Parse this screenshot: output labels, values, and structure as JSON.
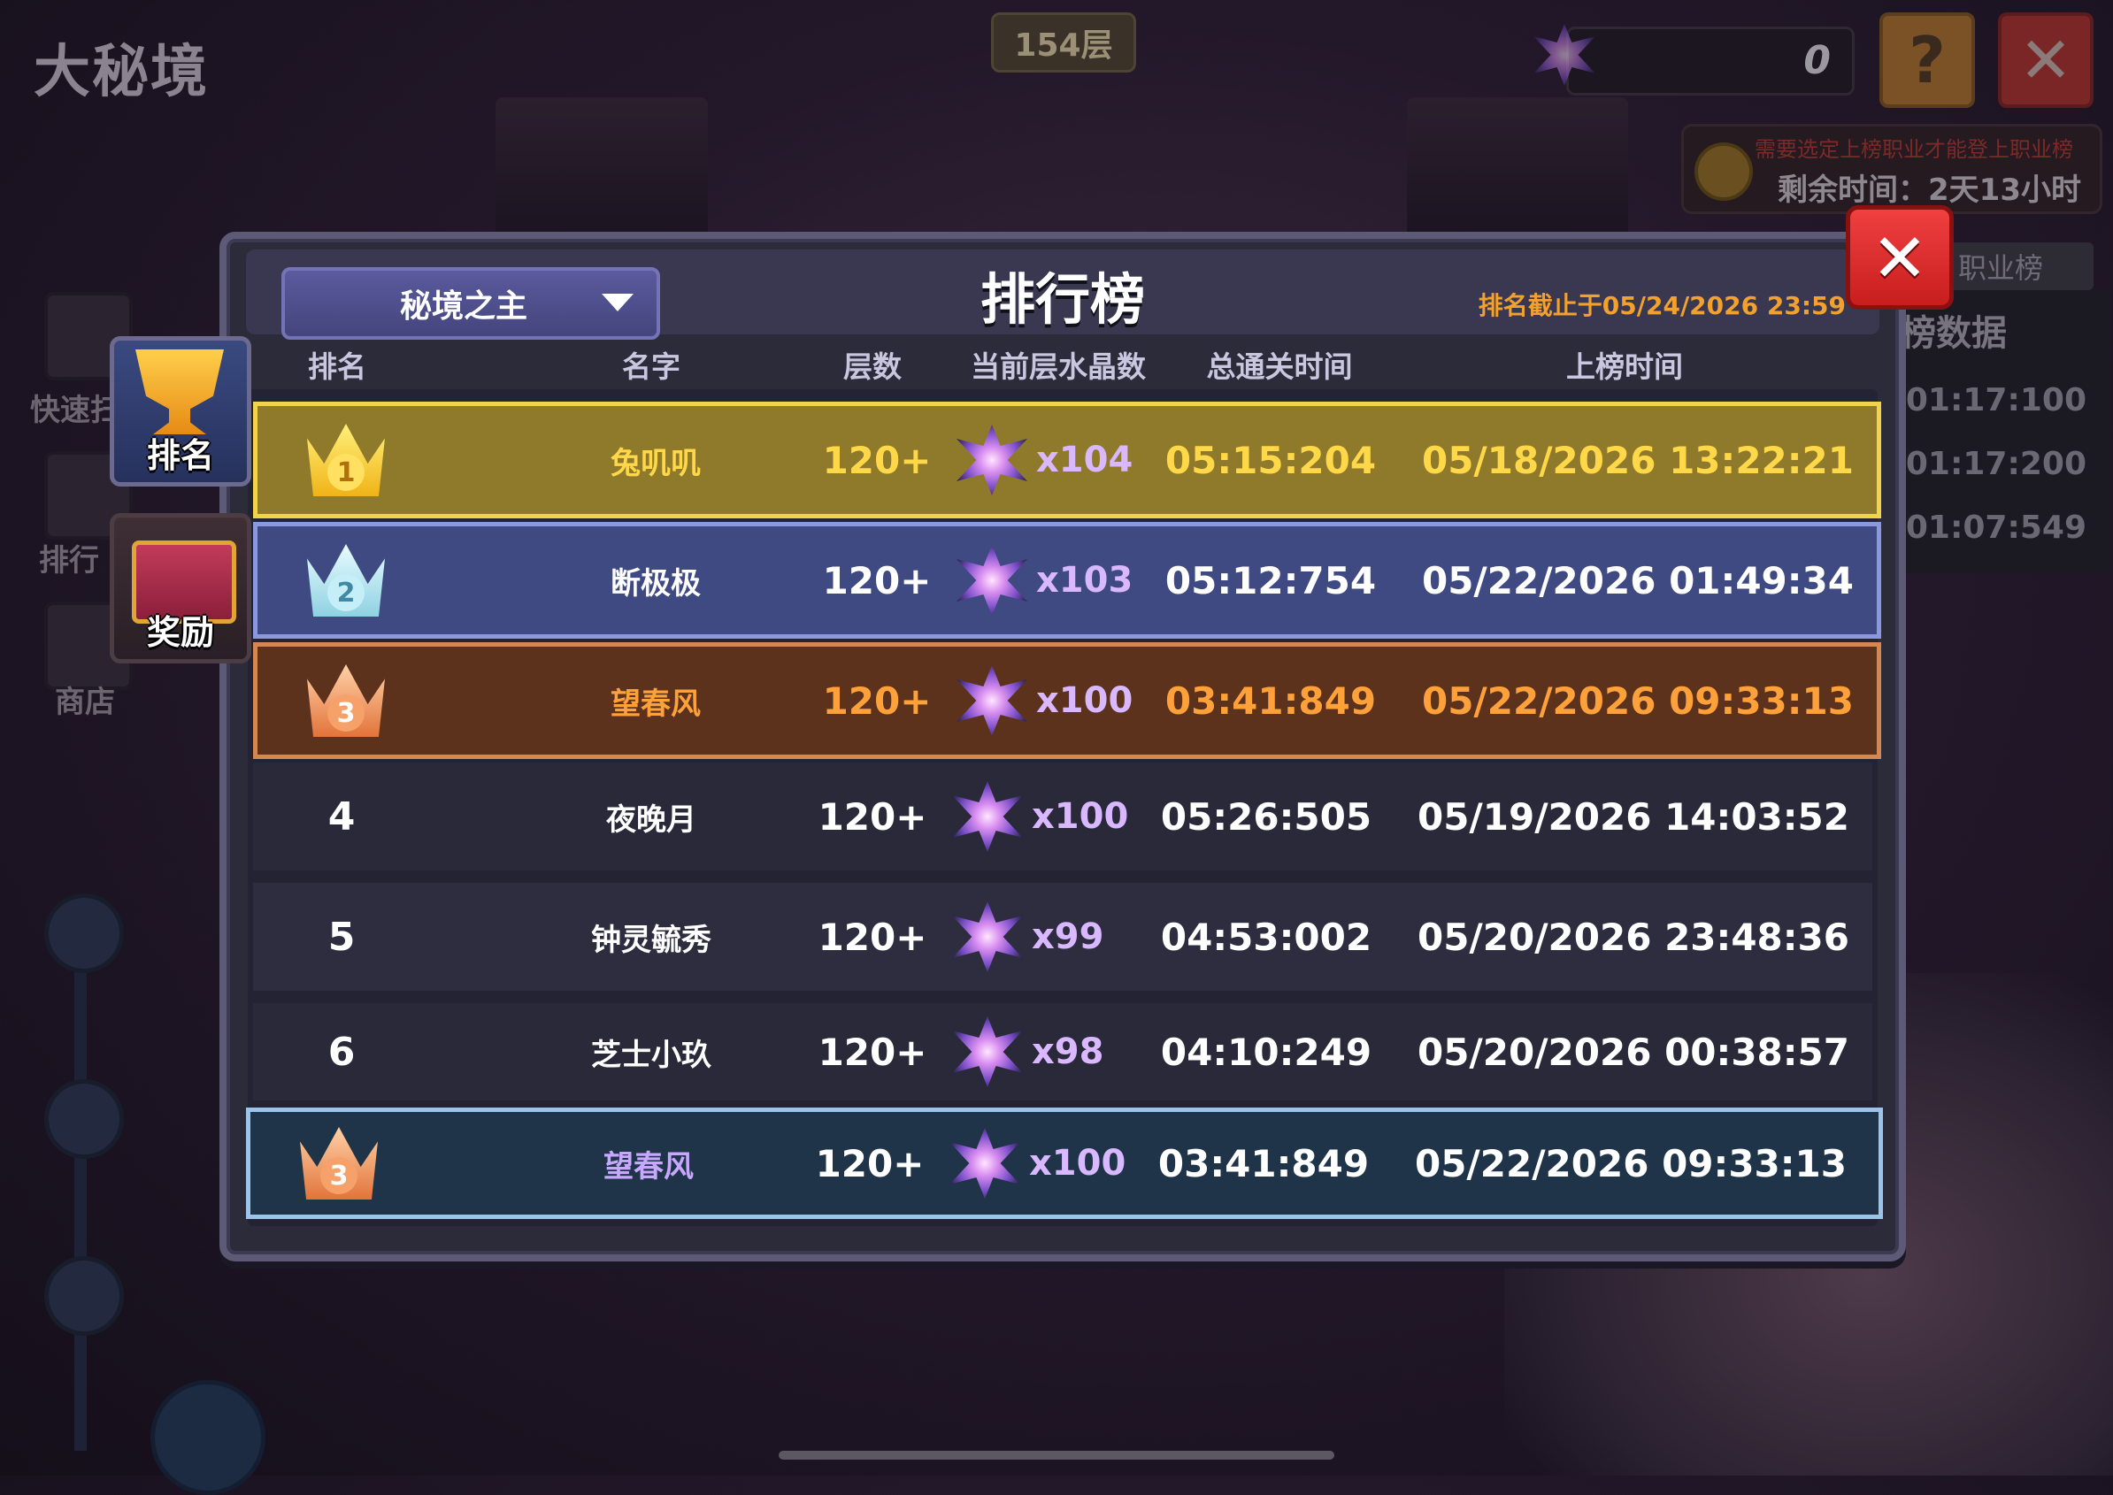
{
  "scene": {
    "title": "大秘境",
    "floor_badge": "154层",
    "crystal_count": "0",
    "help_label": "?",
    "close_label": "✕",
    "timer_warning": "需要选定上榜职业才能登上职业榜",
    "timer_text": "剩余时间：2天13小时",
    "side_tab": "职业榜",
    "side_panel_title": "榜数据",
    "side_times": [
      "01:17:100",
      "01:17:200",
      "01:07:549"
    ],
    "left_labels": [
      "快速扫",
      "排行",
      "商店"
    ]
  },
  "tabs": [
    {
      "label": "排名",
      "icon": "trophy-icon"
    },
    {
      "label": "奖励",
      "icon": "chest-icon"
    }
  ],
  "panel": {
    "dropdown_label": "秘境之主",
    "title": "排行榜",
    "deadline": "排名截止于05/24/2026 23:59",
    "close_label": "✕",
    "columns": [
      "排名",
      "名字",
      "层数",
      "当前层水晶数",
      "总通关时间",
      "上榜时间"
    ]
  },
  "rows": [
    {
      "rank": "1",
      "name": "兔叽叽",
      "floor": "120+",
      "crystals": "x104",
      "total_time": "05:15:204",
      "date": "05/18/2026 13:22:21"
    },
    {
      "rank": "2",
      "name": "断极极",
      "floor": "120+",
      "crystals": "x103",
      "total_time": "05:12:754",
      "date": "05/22/2026 01:49:34"
    },
    {
      "rank": "3",
      "name": "望春风",
      "floor": "120+",
      "crystals": "x100",
      "total_time": "03:41:849",
      "date": "05/22/2026 09:33:13"
    },
    {
      "rank": "4",
      "name": "夜晚月",
      "floor": "120+",
      "crystals": "x100",
      "total_time": "05:26:505",
      "date": "05/19/2026 14:03:52"
    },
    {
      "rank": "5",
      "name": "钟灵毓秀",
      "floor": "120+",
      "crystals": "x99",
      "total_time": "04:53:002",
      "date": "05/20/2026 23:48:36"
    },
    {
      "rank": "6",
      "name": "芝士小玖",
      "floor": "120+",
      "crystals": "x98",
      "total_time": "04:10:249",
      "date": "05/20/2026 00:38:57"
    }
  ],
  "my_row": {
    "rank": "3",
    "name": "望春风",
    "floor": "120+",
    "crystals": "x100",
    "total_time": "03:41:849",
    "date": "05/22/2026 09:33:13"
  },
  "colors": {
    "gold_text": "#ffd84a",
    "bronze_text": "#ffa13a",
    "my_name": "#c8a8ff",
    "white": "#ffffff",
    "crystal_text": "#d9b8ff"
  }
}
